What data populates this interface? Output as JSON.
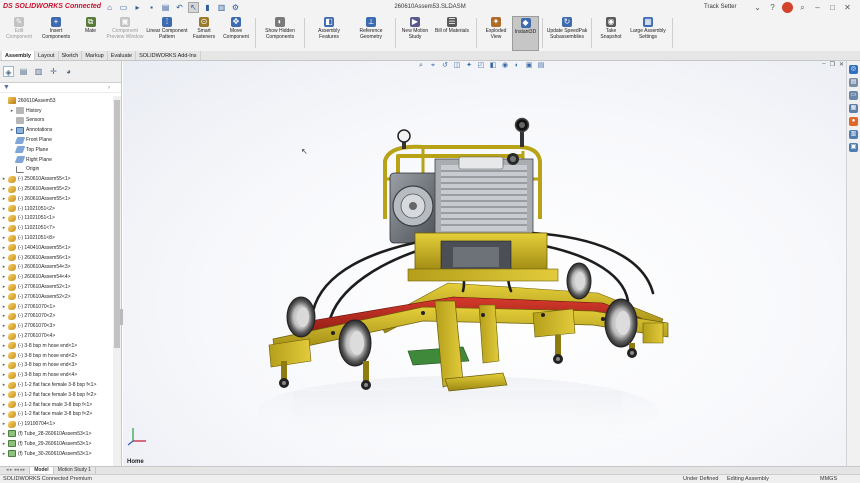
{
  "app": {
    "logo_prefix": "DS",
    "logo": "SOLIDWORKS Connected",
    "document_title": "260610Assem53.SLDASM",
    "user": "Track Setter",
    "avatar_initial": "",
    "colors": {
      "accent": "#c8102e",
      "frame_yellow": "#c8b11c",
      "red_part": "#c0231c",
      "green_part": "#3f8a3a"
    }
  },
  "quick_access": [
    {
      "name": "home",
      "glyph": "⌂"
    },
    {
      "name": "new",
      "glyph": "▭"
    },
    {
      "name": "open",
      "glyph": "▸"
    },
    {
      "name": "save",
      "glyph": "▪"
    },
    {
      "name": "print",
      "glyph": "▤"
    },
    {
      "name": "undo",
      "glyph": "↶"
    },
    {
      "name": "select",
      "glyph": "↖"
    },
    {
      "name": "rebuild",
      "glyph": "▮"
    },
    {
      "name": "file-properties",
      "glyph": "▥"
    },
    {
      "name": "options",
      "glyph": "⚙"
    }
  ],
  "commands": [
    {
      "label": "Edit Component",
      "disabled": true,
      "color": "#8a8a8a",
      "glyph": "✎"
    },
    {
      "label": "Insert Components",
      "color": "#3d6bb0",
      "glyph": "+"
    },
    {
      "label": "Mate",
      "color": "#5a7a3a",
      "glyph": "⧉"
    },
    {
      "label": "Component Preview Window",
      "disabled": true,
      "color": "#8a8a8a",
      "glyph": "▣"
    },
    {
      "label": "Linear Component Pattern",
      "color": "#3d6bb0",
      "glyph": "⁞"
    },
    {
      "label": "Smart Fasteners",
      "color": "#9a7a2a",
      "glyph": "⊙"
    },
    {
      "label": "Move Component",
      "color": "#3d6bb0",
      "glyph": "✥"
    },
    {
      "label": "Show Hidden Components",
      "color": "#7a7a7a",
      "glyph": "◐"
    },
    {
      "label": "Assembly Features",
      "color": "#3d6bb0",
      "glyph": "◧"
    },
    {
      "label": "Reference Geometry",
      "color": "#3d6bb0",
      "glyph": "⟂"
    },
    {
      "label": "New Motion Study",
      "color": "#5a5a8a",
      "glyph": "▶"
    },
    {
      "label": "Bill of Materials",
      "color": "#5a5a5a",
      "glyph": "☰"
    },
    {
      "label": "Exploded View",
      "color": "#b06a2a",
      "glyph": "✦"
    },
    {
      "label": "Instant3D",
      "color": "#3d6bb0",
      "glyph": "◆",
      "active": true
    },
    {
      "label": "Update SpeedPak Subassemblies",
      "color": "#3d6bb0",
      "glyph": "↻"
    },
    {
      "label": "Take Snapshot",
      "color": "#5a5a5a",
      "glyph": "◉"
    },
    {
      "label": "Large Assembly Settings",
      "color": "#3d6bb0",
      "glyph": "▦"
    }
  ],
  "command_tabs": [
    "Assembly",
    "Layout",
    "Sketch",
    "Markup",
    "Evaluate",
    "SOLIDWORKS Add-Ins"
  ],
  "manager_tabs": [
    {
      "name": "feature-manager",
      "glyph": "◈"
    },
    {
      "name": "property-manager",
      "glyph": "▤"
    },
    {
      "name": "configuration-manager",
      "glyph": "▥"
    },
    {
      "name": "dimxpert-manager",
      "glyph": "✛"
    },
    {
      "name": "display-manager",
      "glyph": "◕"
    }
  ],
  "tree": [
    {
      "label": "260610Assem53",
      "icon": "root",
      "exp": "",
      "indent": 0
    },
    {
      "label": "History",
      "icon": "grey",
      "exp": "▸",
      "indent": 1
    },
    {
      "label": "Sensors",
      "icon": "grey",
      "exp": "",
      "indent": 1
    },
    {
      "label": "Annotations",
      "icon": "blue",
      "exp": "▸",
      "indent": 1
    },
    {
      "label": "Front Plane",
      "icon": "plane",
      "exp": "",
      "indent": 1
    },
    {
      "label": "Top Plane",
      "icon": "plane",
      "exp": "",
      "indent": 1
    },
    {
      "label": "Right Plane",
      "icon": "plane",
      "exp": "",
      "indent": 1
    },
    {
      "label": "Origin",
      "icon": "origin",
      "exp": "",
      "indent": 1
    },
    {
      "label": "(-) 250610Assem55<1>",
      "icon": "gold",
      "exp": "▸",
      "indent": 0
    },
    {
      "label": "(-) 250610Assem55<2>",
      "icon": "gold",
      "exp": "▸",
      "indent": 0
    },
    {
      "label": "(-) 260610Assem55<1>",
      "icon": "gold",
      "exp": "▸",
      "indent": 0
    },
    {
      "label": "(-) 11021051<2>",
      "icon": "gold",
      "exp": "▸",
      "indent": 0
    },
    {
      "label": "(-) 11021051<1>",
      "icon": "gold",
      "exp": "▸",
      "indent": 0
    },
    {
      "label": "(-) 11021051<7>",
      "icon": "gold",
      "exp": "▸",
      "indent": 0
    },
    {
      "label": "(-) 11021051<8>",
      "icon": "gold",
      "exp": "▸",
      "indent": 0
    },
    {
      "label": "(-) 140410Assem55<1>",
      "icon": "gold",
      "exp": "▸",
      "indent": 0
    },
    {
      "label": "(-) 260610Assem56<1>",
      "icon": "gold",
      "exp": "▸",
      "indent": 0
    },
    {
      "label": "(-) 260610Assem54<3>",
      "icon": "gold",
      "exp": "▸",
      "indent": 0
    },
    {
      "label": "(-) 260610Assem54<4>",
      "icon": "gold",
      "exp": "▸",
      "indent": 0
    },
    {
      "label": "(-) 270610Assem52<1>",
      "icon": "gold",
      "exp": "▸",
      "indent": 0
    },
    {
      "label": "(-) 270610Assem52<2>",
      "icon": "gold",
      "exp": "▸",
      "indent": 0
    },
    {
      "label": "(-) 27061070<1>",
      "icon": "gold",
      "exp": "▸",
      "indent": 0
    },
    {
      "label": "(-) 27061070<2>",
      "icon": "gold",
      "exp": "▸",
      "indent": 0
    },
    {
      "label": "(-) 27061070<3>",
      "icon": "gold",
      "exp": "▸",
      "indent": 0
    },
    {
      "label": "(-) 27061070<4>",
      "icon": "gold",
      "exp": "▸",
      "indent": 0
    },
    {
      "label": "(-) 3-8 bsp m hose end<1>",
      "icon": "gold",
      "exp": "▸",
      "indent": 0
    },
    {
      "label": "(-) 3-8 bsp m hose end<2>",
      "icon": "gold",
      "exp": "▸",
      "indent": 0
    },
    {
      "label": "(-) 3-8 bsp m hose end<3>",
      "icon": "gold",
      "exp": "▸",
      "indent": 0
    },
    {
      "label": "(-) 3-8 bsp m hose end<4>",
      "icon": "gold",
      "exp": "▸",
      "indent": 0
    },
    {
      "label": "(-) 1-2 flat face female 3-8 bsp f<1>",
      "icon": "gold",
      "exp": "▸",
      "indent": 0
    },
    {
      "label": "(-) 1-2 flat face female 3-8 bsp f<2>",
      "icon": "gold",
      "exp": "▸",
      "indent": 0
    },
    {
      "label": "(-) 1-2 flat face male 3-8 bsp f<1>",
      "icon": "gold",
      "exp": "▸",
      "indent": 0
    },
    {
      "label": "(-) 1-2 flat face male 3-8 bsp f<2>",
      "icon": "gold",
      "exp": "▸",
      "indent": 0
    },
    {
      "label": "(-) 19100704<1>",
      "icon": "gold",
      "exp": "▸",
      "indent": 0
    },
    {
      "label": "(f) Tube_28-260610Assem53<1>",
      "icon": "green",
      "exp": "▸",
      "indent": 0
    },
    {
      "label": "(f) Tube_29-260610Assem53<1>",
      "icon": "green",
      "exp": "▸",
      "indent": 0
    },
    {
      "label": "(f) Tube_30-260610Assem53<1>",
      "icon": "green",
      "exp": "▸",
      "indent": 0
    }
  ],
  "task_pane": [
    {
      "name": "solidworks-resources",
      "color": "#2e6fc0",
      "glyph": "◎"
    },
    {
      "name": "design-library",
      "color": "#7b8ea8",
      "glyph": "▤"
    },
    {
      "name": "file-explorer",
      "color": "#6b86a8",
      "glyph": "▭"
    },
    {
      "name": "view-palette",
      "color": "#5f7fa6",
      "glyph": "▦"
    },
    {
      "name": "appearances",
      "color": "#e0682a",
      "glyph": "●"
    },
    {
      "name": "custom-properties",
      "color": "#4f7fb0",
      "glyph": "▥"
    },
    {
      "name": "solidworks-forum",
      "color": "#4f7fb0",
      "glyph": "▣"
    }
  ],
  "heads_up": [
    {
      "name": "zoom-to-fit",
      "glyph": "⌕"
    },
    {
      "name": "zoom-to-area",
      "glyph": "⌖"
    },
    {
      "name": "previous-view",
      "glyph": "↺"
    },
    {
      "name": "section-view",
      "glyph": "◫"
    },
    {
      "name": "dynamic-annotation",
      "glyph": "✦"
    },
    {
      "name": "view-orientation",
      "glyph": "◰"
    },
    {
      "name": "display-style",
      "glyph": "◧"
    },
    {
      "name": "hide-show-items",
      "glyph": "◉"
    },
    {
      "name": "edit-appearance",
      "glyph": "◐"
    },
    {
      "name": "apply-scene",
      "glyph": "▣"
    },
    {
      "name": "view-settings",
      "glyph": "▤"
    }
  ],
  "viewport": {
    "home_label": "Home"
  },
  "bottom_tabs": [
    "Model",
    "Motion Study 1"
  ],
  "status": {
    "product": "SOLIDWORKS Connected Premium",
    "definition": "Under Defined",
    "mode": "Editing Assembly",
    "units": "MMGS"
  }
}
